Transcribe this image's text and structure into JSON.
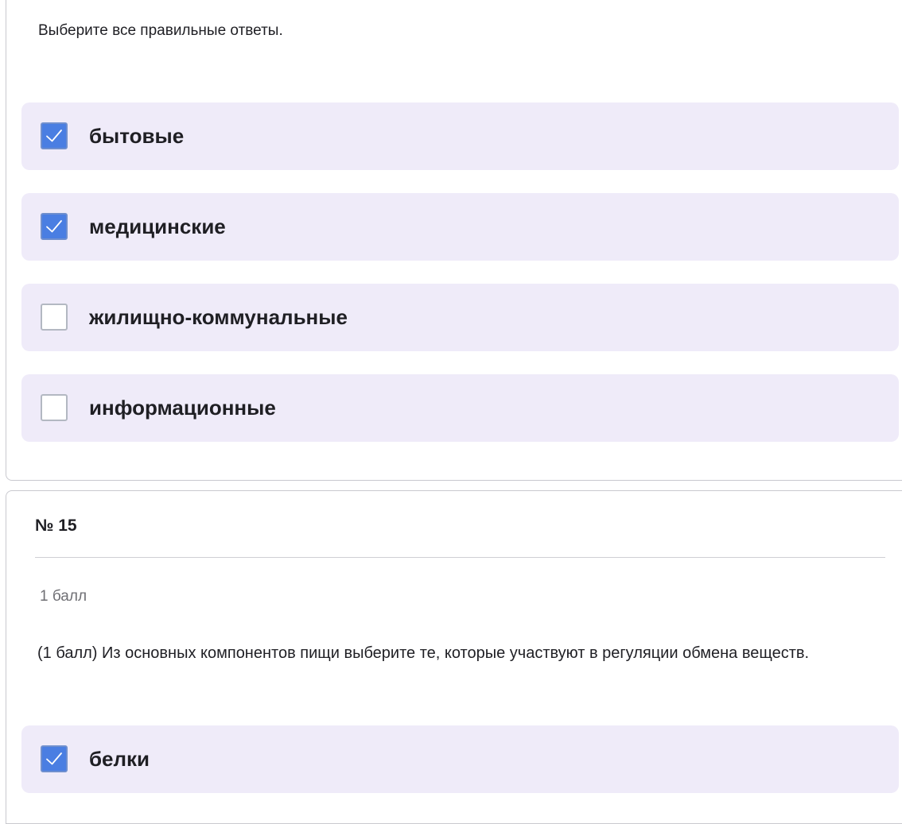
{
  "question_14": {
    "instruction": "Выберите все правильные ответы.",
    "options": [
      {
        "label": "бытовые",
        "checked": true
      },
      {
        "label": "медицинские",
        "checked": true
      },
      {
        "label": "жилищно-коммунальные",
        "checked": false
      },
      {
        "label": "информационные",
        "checked": false
      }
    ]
  },
  "question_15": {
    "number": "№ 15",
    "points": "1 балл",
    "text": "(1 балл) Из основных компонентов пищи выберите те, которые участвуют в регуляции обмена веществ.",
    "options": [
      {
        "label": "белки",
        "checked": true
      }
    ]
  },
  "colors": {
    "option_background": "#efebf9",
    "checkbox_checked": "#4a7ee2",
    "checkbox_unchecked_border": "#b3b8c2"
  }
}
